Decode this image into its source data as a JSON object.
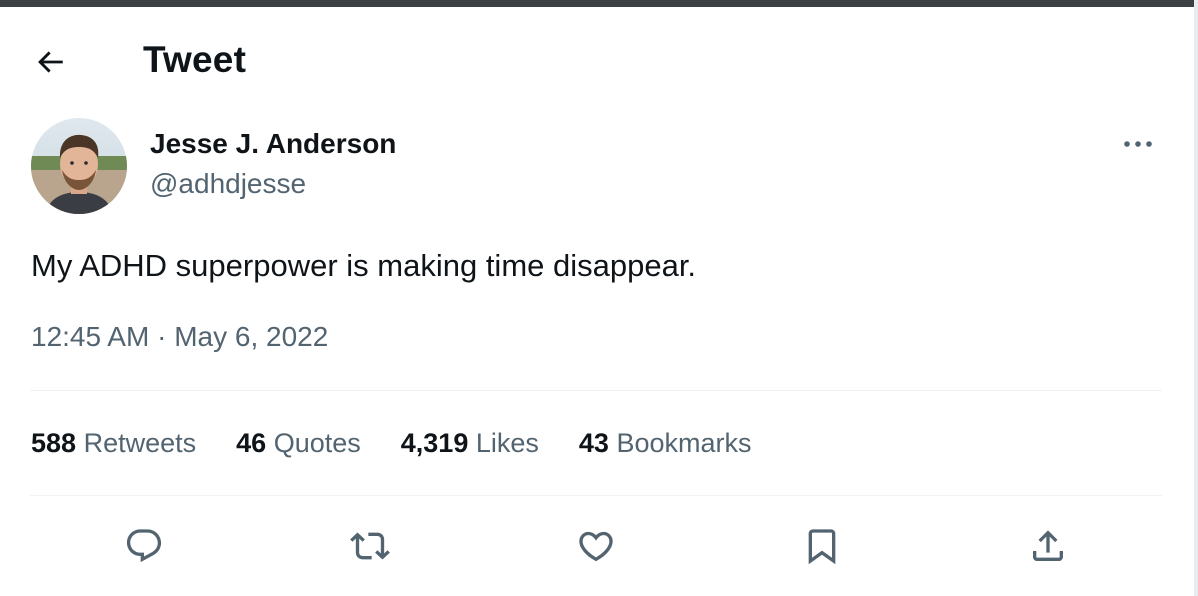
{
  "header": {
    "back_label": "Back",
    "title": "Tweet"
  },
  "tweet": {
    "author": {
      "name": "Jesse J. Anderson",
      "handle": "@adhdjesse"
    },
    "text": "My ADHD superpower is making time disappear.",
    "time": "12:45 AM",
    "separator": "·",
    "date": "May 6, 2022"
  },
  "stats": [
    {
      "count": "588",
      "label": "Retweets"
    },
    {
      "count": "46",
      "label": "Quotes"
    },
    {
      "count": "4,319",
      "label": "Likes"
    },
    {
      "count": "43",
      "label": "Bookmarks"
    }
  ],
  "actions": [
    {
      "icon": "reply-icon"
    },
    {
      "icon": "retweet-icon"
    },
    {
      "icon": "like-icon"
    },
    {
      "icon": "bookmark-icon"
    },
    {
      "icon": "share-icon"
    }
  ],
  "colors": {
    "text_primary": "#0f1419",
    "text_secondary": "#536471",
    "divider": "#eff3f4"
  }
}
